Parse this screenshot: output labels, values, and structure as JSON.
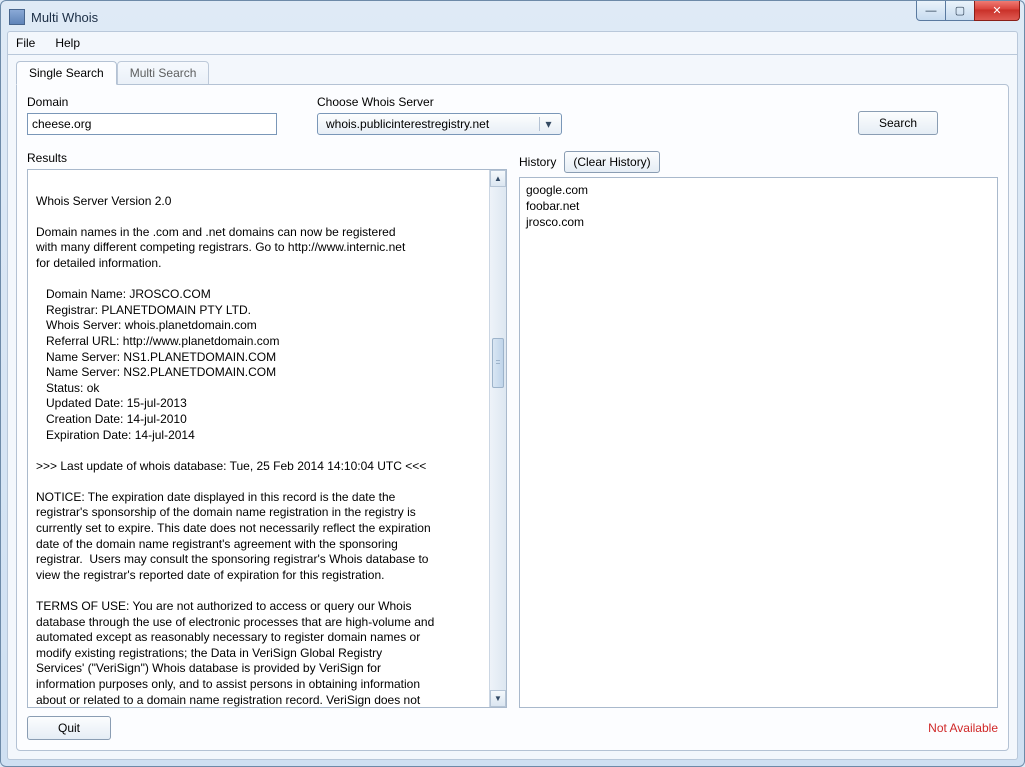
{
  "window": {
    "title": "Multi Whois"
  },
  "menubar": {
    "file": "File",
    "help": "Help"
  },
  "tabs": {
    "single": "Single Search",
    "multi": "Multi Search"
  },
  "form": {
    "domain_label": "Domain",
    "domain_value": "cheese.org",
    "server_label": "Choose Whois Server",
    "server_value": "whois.publicinterestregistry.net",
    "search_label": "Search"
  },
  "results": {
    "label": "Results",
    "text_top": "Whois Server Version 2.0\n\nDomain names in the .com and .net domains can now be registered\nwith many different competing registrars. Go to http://www.internic.net\nfor detailed information.\n",
    "details": "   Domain Name: JROSCO.COM\n   Registrar: PLANETDOMAIN PTY LTD.\n   Whois Server: whois.planetdomain.com\n   Referral URL: http://www.planetdomain.com\n   Name Server: NS1.PLANETDOMAIN.COM\n   Name Server: NS2.PLANETDOMAIN.COM\n   Status: ok\n   Updated Date: 15-jul-2013\n   Creation Date: 14-jul-2010\n   Expiration Date: 14-jul-2014\n",
    "last_update": ">>> Last update of whois database: Tue, 25 Feb 2014 14:10:04 UTC <<<",
    "notice": "NOTICE: The expiration date displayed in this record is the date the\nregistrar's sponsorship of the domain name registration in the registry is\ncurrently set to expire. This date does not necessarily reflect the expiration\ndate of the domain name registrant's agreement with the sponsoring\nregistrar.  Users may consult the sponsoring registrar's Whois database to\nview the registrar's reported date of expiration for this registration.",
    "terms": "TERMS OF USE: You are not authorized to access or query our Whois\ndatabase through the use of electronic processes that are high-volume and\nautomated except as reasonably necessary to register domain names or\nmodify existing registrations; the Data in VeriSign Global Registry\nServices' (\"VeriSign\") Whois database is provided by VeriSign for\ninformation purposes only, and to assist persons in obtaining information\nabout or related to a domain name registration record. VeriSign does not\nguarantee its accuracy. By submitting a Whois query, you agree to abide"
  },
  "history": {
    "label": "History",
    "clear_label": "(Clear History)",
    "items": [
      "google.com",
      "foobar.net",
      "jrosco.com"
    ]
  },
  "bottom": {
    "quit_label": "Quit",
    "status": "Not Available"
  }
}
